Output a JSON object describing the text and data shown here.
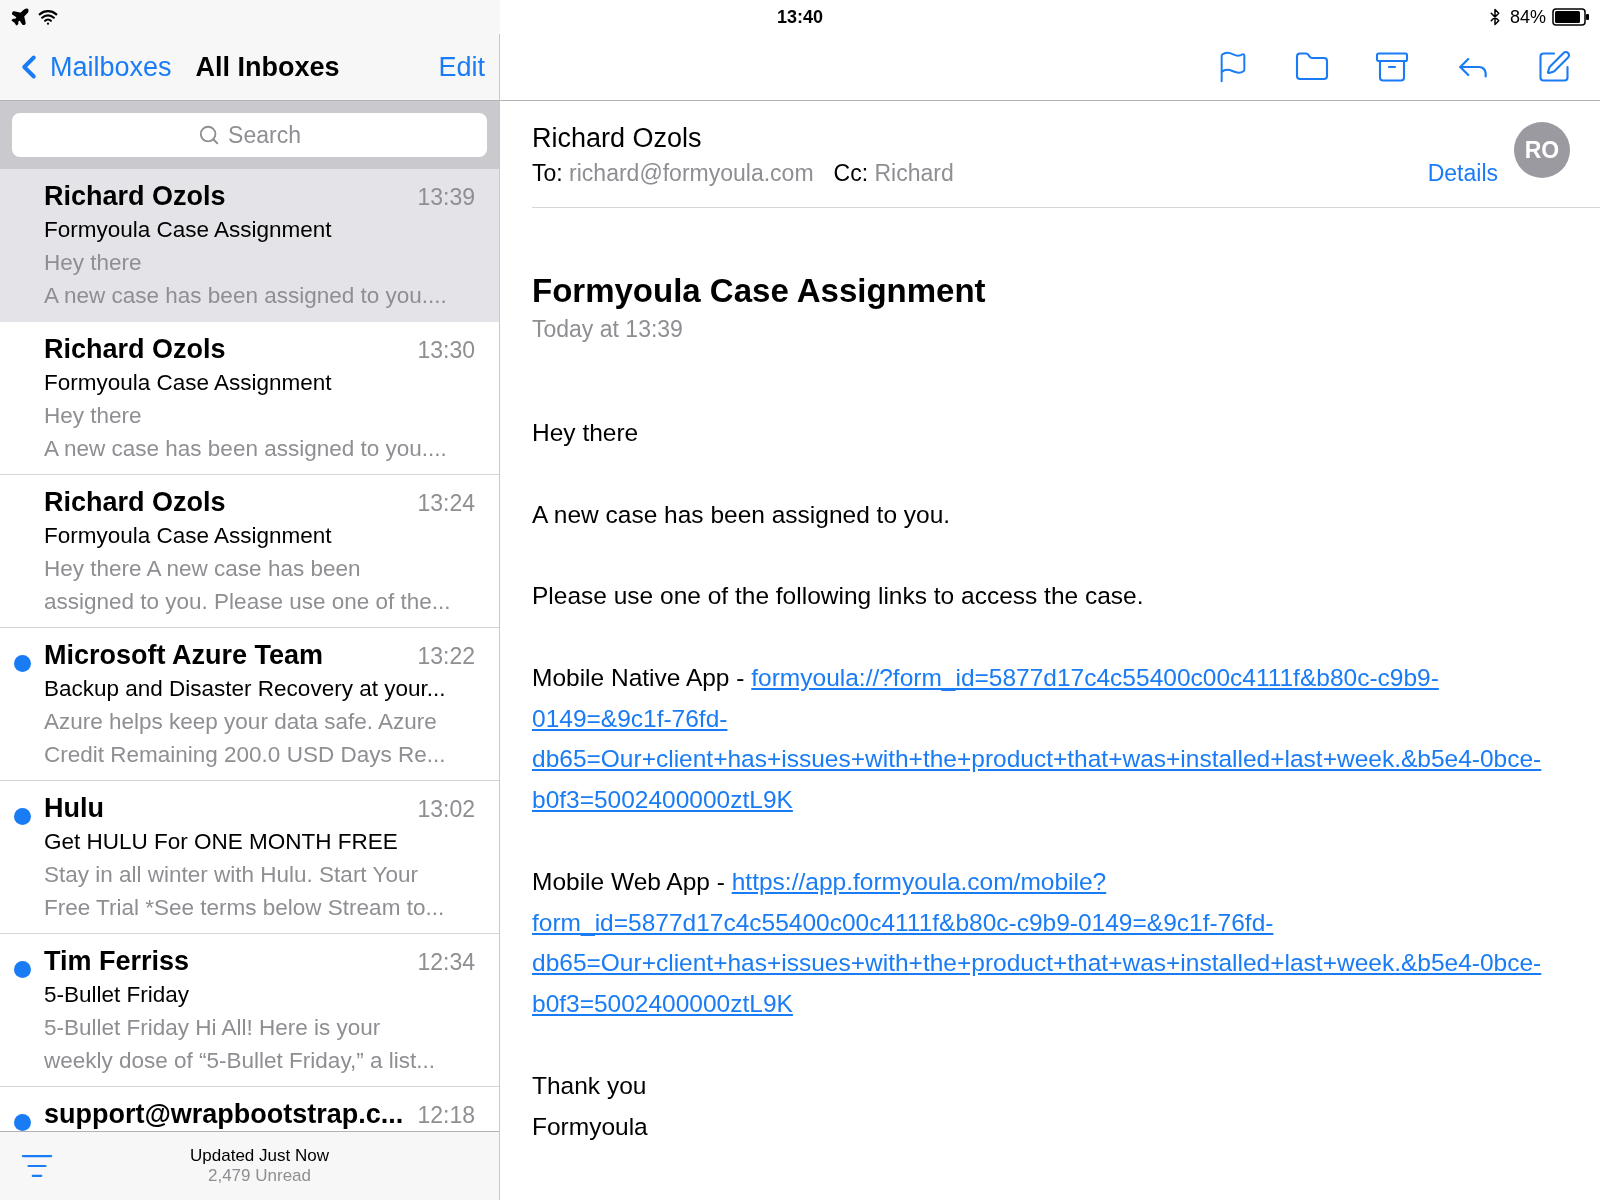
{
  "status_bar": {
    "time": "13:40",
    "battery": "84%"
  },
  "nav": {
    "back": "Mailboxes",
    "title": "All Inboxes",
    "edit": "Edit"
  },
  "search": {
    "placeholder": "Search"
  },
  "messages": [
    {
      "sender": "Richard Ozols",
      "time": "13:39",
      "subject": "Formyoula Case Assignment",
      "preview": [
        "Hey there",
        "A new case has been assigned to you...."
      ],
      "unread": false,
      "selected": true
    },
    {
      "sender": "Richard Ozols",
      "time": "13:30",
      "subject": "Formyoula Case Assignment",
      "preview": [
        "Hey there",
        "A new case has been assigned to you...."
      ],
      "unread": false,
      "selected": false
    },
    {
      "sender": "Richard Ozols",
      "time": "13:24",
      "subject": "Formyoula Case Assignment",
      "preview": [
        "Hey there A new case has been",
        "assigned to you. Please use one of the..."
      ],
      "unread": false,
      "selected": false
    },
    {
      "sender": "Microsoft Azure Team",
      "time": "13:22",
      "subject": "Backup and Disaster Recovery at your...",
      "preview": [
        "Azure helps keep your data safe. Azure",
        "Credit Remaining 200.0 USD Days Re..."
      ],
      "unread": true,
      "selected": false
    },
    {
      "sender": "Hulu",
      "time": "13:02",
      "subject": "Get HULU For ONE MONTH FREE",
      "preview": [
        "Stay in all winter with Hulu. Start Your",
        "Free Trial *See terms below Stream to..."
      ],
      "unread": true,
      "selected": false
    },
    {
      "sender": "Tim Ferriss",
      "time": "12:34",
      "subject": "5-Bullet Friday",
      "preview": [
        "5-Bullet Friday Hi All! Here is your",
        "weekly dose of “5-Bullet Friday,” a list..."
      ],
      "unread": true,
      "selected": false
    },
    {
      "sender": "support@wrapbootstrap.c...",
      "time": "12:18",
      "unread": true,
      "selected": false
    }
  ],
  "footer": {
    "updated": "Updated Just Now",
    "unread": "2,479 Unread"
  },
  "email": {
    "from": "Richard Ozols",
    "to_label": "To:",
    "to": "richard@formyoula.com",
    "cc_label": "Cc:",
    "cc": "Richard",
    "details": "Details",
    "avatar": "RO",
    "subject": "Formyoula Case Assignment",
    "date": "Today at 13:39",
    "body": [
      {
        "kind": "text",
        "text": "Hey there"
      },
      {
        "kind": "text",
        "text": "A new case has been assigned to you."
      },
      {
        "kind": "text",
        "text": "Please use one of the following links to access the case."
      },
      {
        "kind": "link",
        "label": "Mobile Native App - ",
        "url": "formyoula://?form_id=5877d17c4c55400c00c4111f&b80c-c9b9-0149=&9c1f-76fd-db65=Our+client+has+issues+with+the+product+that+was+installed+last+week.&b5e4-0bce-b0f3=5002400000ztL9K"
      },
      {
        "kind": "link",
        "label": "Mobile Web App - ",
        "url": "https://app.formyoula.com/mobile?form_id=5877d17c4c55400c00c4111f&b80c-c9b9-0149=&9c1f-76fd-db65=Our+client+has+issues+with+the+product+that+was+installed+last+week.&b5e4-0bce-b0f3=5002400000ztL9K"
      },
      {
        "kind": "lines",
        "lines": [
          "Thank you",
          "Formyoula"
        ]
      }
    ]
  }
}
